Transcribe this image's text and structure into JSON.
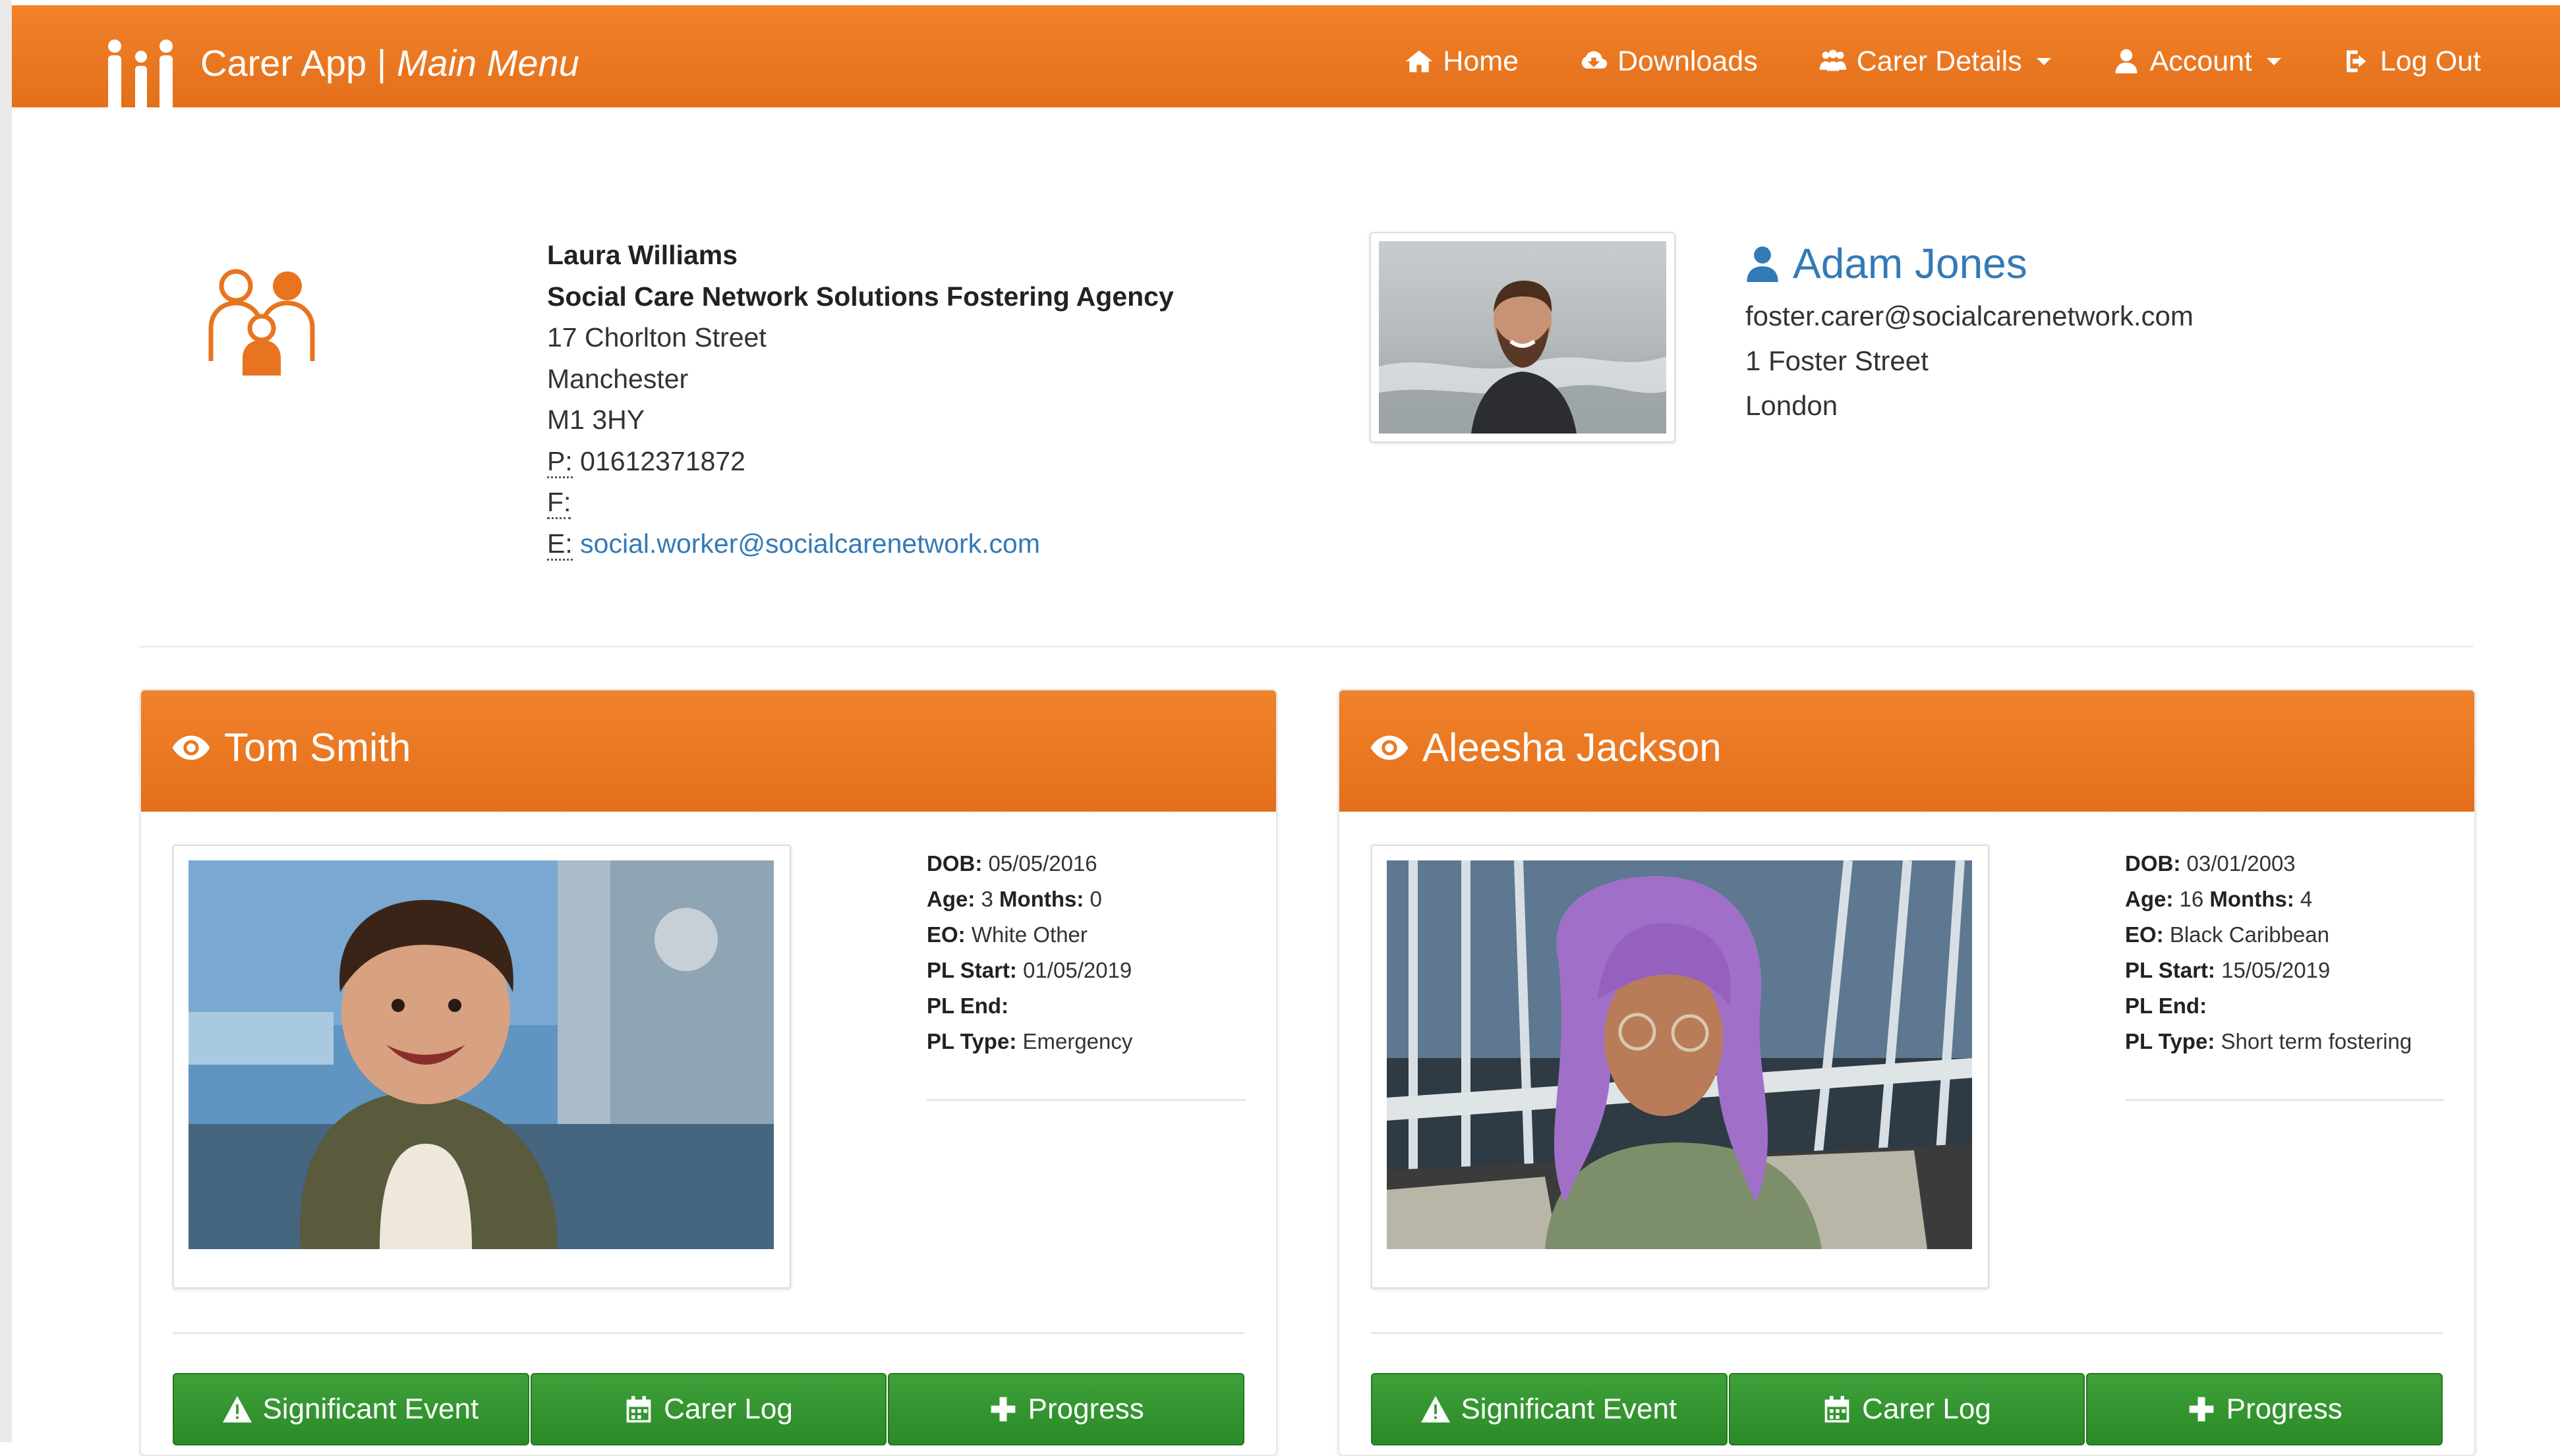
{
  "app": {
    "title": "Carer App",
    "separator": "|",
    "subtitle": "Main Menu"
  },
  "nav": {
    "home": "Home",
    "downloads": "Downloads",
    "carer_details": "Carer Details",
    "account": "Account",
    "logout": "Log Out"
  },
  "social_worker": {
    "name": "Laura Williams",
    "agency": "Social Care Network Solutions Fostering Agency",
    "street": "17 Chorlton Street",
    "city": "Manchester",
    "postcode": "M1 3HY",
    "phone_label": "P:",
    "phone": "01612371872",
    "fax_label": "F:",
    "fax": "",
    "email_label": "E:",
    "email": "social.worker@socialcarenetwork.com"
  },
  "carer": {
    "name": "Adam Jones",
    "email": "foster.carer@socialcarenetwork.com",
    "street": "1 Foster Street",
    "city": "London"
  },
  "detail_labels": {
    "dob": "DOB:",
    "age": "Age:",
    "months": "Months:",
    "eo": "EO:",
    "pl_start": "PL Start:",
    "pl_end": "PL End:",
    "pl_type": "PL Type:"
  },
  "children": [
    {
      "name": "Tom Smith",
      "dob": "05/05/2016",
      "age": "3",
      "months": "0",
      "eo": "White Other",
      "pl_start": "01/05/2019",
      "pl_end": "",
      "pl_type": "Emergency"
    },
    {
      "name": "Aleesha Jackson",
      "dob": "03/01/2003",
      "age": "16",
      "months": "4",
      "eo": "Black Caribbean",
      "pl_start": "15/05/2019",
      "pl_end": "",
      "pl_type": "Short term fostering"
    }
  ],
  "buttons": {
    "significant_event": "Significant Event",
    "carer_log": "Carer Log",
    "progress": "Progress"
  },
  "colors": {
    "brand_orange": "#e8741f",
    "button_green": "#2f8f2b",
    "link_blue": "#337ab7"
  }
}
